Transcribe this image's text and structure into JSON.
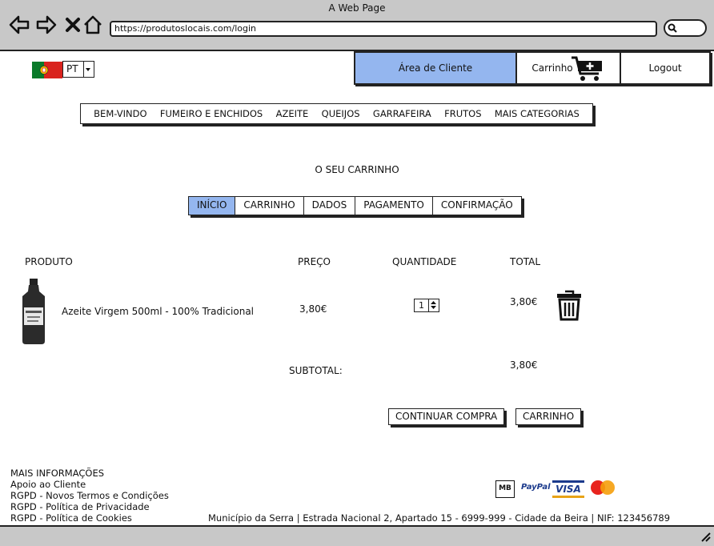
{
  "browser": {
    "title": "A Web Page",
    "url": "https://produtoslocais.com/login"
  },
  "header": {
    "language": "PT",
    "client_area": "Área de Cliente",
    "cart": "Carrinho",
    "logout": "Logout"
  },
  "nav": [
    "BEM-VINDO",
    "FUMEIRO E ENCHIDOS",
    "AZEITE",
    "QUEIJOS",
    "GARRAFEIRA",
    "FRUTOS",
    "MAIS CATEGORIAS"
  ],
  "cart_title": "O SEU CARRINHO",
  "steps": [
    "INÍCIO",
    "CARRINHO",
    "DADOS",
    "PAGAMENTO",
    "CONFIRMAÇÃO"
  ],
  "active_step": 0,
  "table": {
    "headers": {
      "product": "PRODUTO",
      "price": "PREÇO",
      "quantity": "QUANTIDADE",
      "total": "TOTAL"
    },
    "row": {
      "product": "Azeite Virgem 500ml - 100% Tradicional",
      "price": "3,80€",
      "quantity": "1",
      "total": "3,80€"
    },
    "subtotal_label": "SUBTOTAL:",
    "subtotal_value": "3,80€"
  },
  "actions": {
    "continue": "CONTINUAR COMPRA",
    "cart": "CARRINHO"
  },
  "footer": {
    "heading": "MAIS INFORMAÇÕES",
    "links": [
      "Apoio ao Cliente",
      "RGPD - Novos Termos e Condições",
      "RGPD - Política de Privacidade",
      "RGPD - Política de Cookies"
    ],
    "address": "Município da Serra | Estrada Nacional 2, Apartado 15 - 6999-999 - Cidade da Beira | NIF: 123456789",
    "payment_logos": [
      "MB",
      "PayPal",
      "VISA",
      "mastercard"
    ]
  },
  "colors": {
    "accent": "#94b6ef",
    "chrome": "#c8c8c8",
    "flag_green": "#0a7a2a",
    "flag_red": "#d9231d"
  }
}
